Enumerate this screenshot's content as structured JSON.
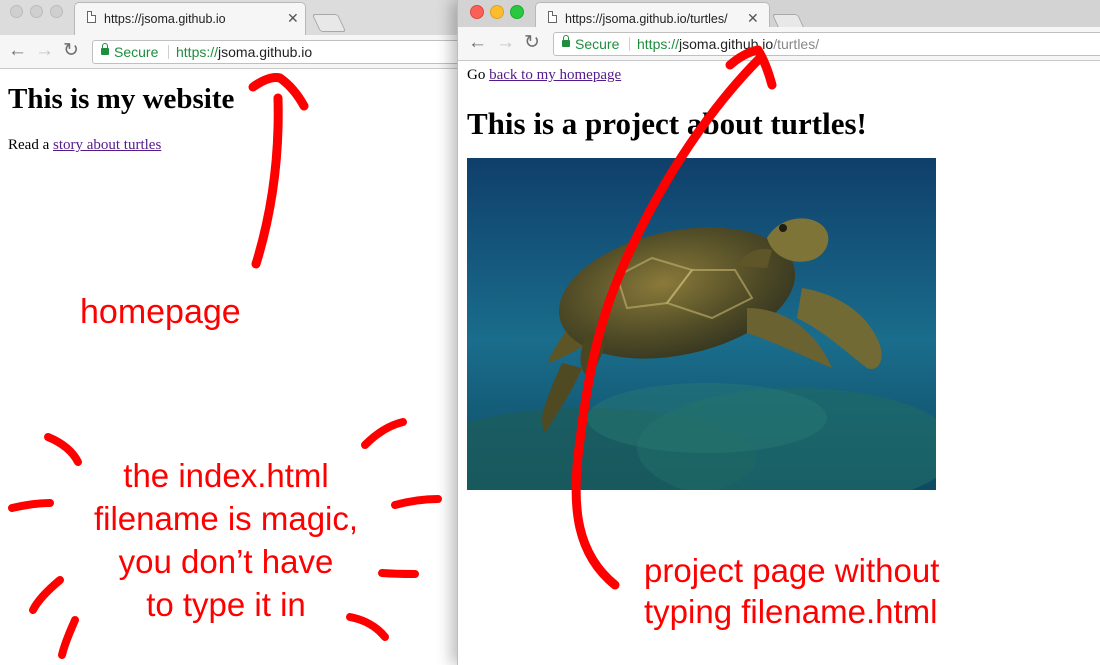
{
  "left_window": {
    "tab": {
      "title": "https://jsoma.github.io"
    },
    "omnibox": {
      "secure_label": "Secure",
      "url_scheme": "https://",
      "url_host": "jsoma.github.io",
      "url_path": ""
    },
    "page": {
      "heading": "This is my website",
      "text_prefix": "Read a ",
      "link_text": "story about turtles"
    }
  },
  "right_window": {
    "tab": {
      "title": "https://jsoma.github.io/turtles/"
    },
    "omnibox": {
      "secure_label": "Secure",
      "url_scheme": "https://",
      "url_host": "jsoma.github.io",
      "url_path": "/turtles/"
    },
    "page": {
      "text_prefix": "Go ",
      "link_text": "back to my homepage",
      "heading": "This is a project about turtles!",
      "image_subject": "sea turtle swimming underwater"
    }
  },
  "annotations": {
    "homepage_label": "homepage",
    "index_note": [
      "the index.html",
      "filename is magic,",
      "you don’t have",
      "to type it in"
    ],
    "project_note": [
      "project page without",
      "typing filename.html"
    ],
    "color": "#ff0000"
  },
  "icons": [
    "page-icon",
    "close-icon",
    "back-arrow-icon",
    "forward-arrow-icon",
    "reload-icon",
    "lock-icon"
  ]
}
